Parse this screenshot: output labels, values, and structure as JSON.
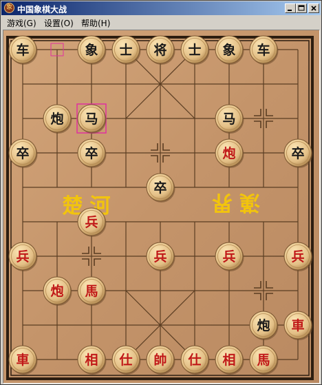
{
  "window": {
    "title": "中国象棋大战",
    "app_icon_glyph": "象",
    "colors": {
      "title_start": "#0a246a",
      "title_end": "#a6caf0",
      "chrome": "#d4d0c8"
    }
  },
  "titlebar_buttons": [
    {
      "name": "minimize-button",
      "icon": "minimize-icon"
    },
    {
      "name": "maximize-button",
      "icon": "maximize-icon"
    },
    {
      "name": "close-button",
      "icon": "close-icon"
    }
  ],
  "menu": {
    "game": "游戏(G)",
    "settings": "设置(O)",
    "help": "帮助(H)"
  },
  "board": {
    "river_left": "楚河",
    "river_right": "漢界",
    "river_right_rotated": true,
    "colors": {
      "wood": "#c99a6e",
      "line": "#5a3d22",
      "piece": "#e3bf86",
      "black_text": "#1a1a1a",
      "red_text": "#c01818",
      "river_text": "#f2c40d",
      "selection": "#e030a0"
    },
    "last_move": {
      "from": [
        1,
        0
      ],
      "to": [
        2,
        2
      ]
    }
  },
  "pieces": [
    {
      "text": "车",
      "side": "black",
      "col": 0,
      "row": 0
    },
    {
      "text": "象",
      "side": "black",
      "col": 2,
      "row": 0
    },
    {
      "text": "士",
      "side": "black",
      "col": 3,
      "row": 0
    },
    {
      "text": "将",
      "side": "black",
      "col": 4,
      "row": 0
    },
    {
      "text": "士",
      "side": "black",
      "col": 5,
      "row": 0
    },
    {
      "text": "象",
      "side": "black",
      "col": 6,
      "row": 0
    },
    {
      "text": "车",
      "side": "black",
      "col": 7,
      "row": 0
    },
    {
      "text": "炮",
      "side": "black",
      "col": 1,
      "row": 2
    },
    {
      "text": "马",
      "side": "black",
      "col": 2,
      "row": 2
    },
    {
      "text": "马",
      "side": "black",
      "col": 6,
      "row": 2
    },
    {
      "text": "卒",
      "side": "black",
      "col": 0,
      "row": 3
    },
    {
      "text": "卒",
      "side": "black",
      "col": 2,
      "row": 3
    },
    {
      "text": "炮",
      "side": "red",
      "col": 6,
      "row": 3
    },
    {
      "text": "卒",
      "side": "black",
      "col": 8,
      "row": 3
    },
    {
      "text": "卒",
      "side": "black",
      "col": 4,
      "row": 4
    },
    {
      "text": "兵",
      "side": "red",
      "col": 2,
      "row": 5
    },
    {
      "text": "兵",
      "side": "red",
      "col": 0,
      "row": 6
    },
    {
      "text": "兵",
      "side": "red",
      "col": 4,
      "row": 6
    },
    {
      "text": "兵",
      "side": "red",
      "col": 6,
      "row": 6
    },
    {
      "text": "兵",
      "side": "red",
      "col": 8,
      "row": 6
    },
    {
      "text": "炮",
      "side": "red",
      "col": 1,
      "row": 7
    },
    {
      "text": "馬",
      "side": "red",
      "col": 2,
      "row": 7
    },
    {
      "text": "炮",
      "side": "black",
      "col": 7,
      "row": 8
    },
    {
      "text": "車",
      "side": "red",
      "col": 8,
      "row": 8
    },
    {
      "text": "車",
      "side": "red",
      "col": 0,
      "row": 9
    },
    {
      "text": "相",
      "side": "red",
      "col": 2,
      "row": 9
    },
    {
      "text": "仕",
      "side": "red",
      "col": 3,
      "row": 9
    },
    {
      "text": "帥",
      "side": "red",
      "col": 4,
      "row": 9
    },
    {
      "text": "仕",
      "side": "red",
      "col": 5,
      "row": 9
    },
    {
      "text": "相",
      "side": "red",
      "col": 6,
      "row": 9
    },
    {
      "text": "馬",
      "side": "red",
      "col": 7,
      "row": 9
    }
  ]
}
